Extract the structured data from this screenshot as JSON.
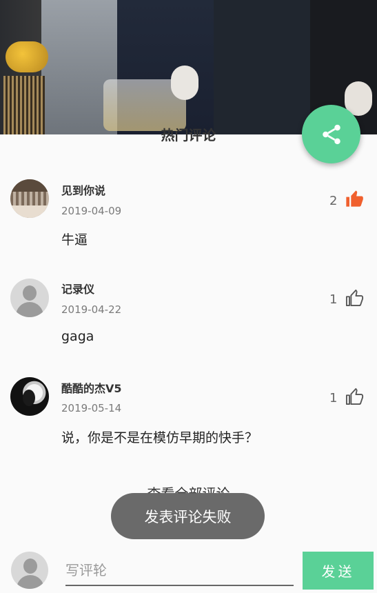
{
  "header": {
    "section_title": "热门评论"
  },
  "fab": {
    "icon": "share-icon",
    "color": "#5ad197"
  },
  "comments": [
    {
      "name": "见到你说",
      "date": "2019-04-09",
      "text": "牛逼",
      "likes": "2",
      "liked": true
    },
    {
      "name": "记录仪",
      "date": "2019-04-22",
      "text": "gaga",
      "likes": "1",
      "liked": false
    },
    {
      "name": "酷酷的杰V5",
      "date": "2019-05-14",
      "text": "说，你是不是在模仿早期的快手？",
      "likes": "1",
      "liked": false
    }
  ],
  "see_all_label": "查看全部评论",
  "toast": {
    "message": "发表评论失败"
  },
  "composer": {
    "placeholder": "写评轮",
    "value": "",
    "send_label": "发送"
  },
  "colors": {
    "accent": "#5ad197",
    "liked": "#f0602e",
    "toast_bg": "#6a6a6a"
  }
}
